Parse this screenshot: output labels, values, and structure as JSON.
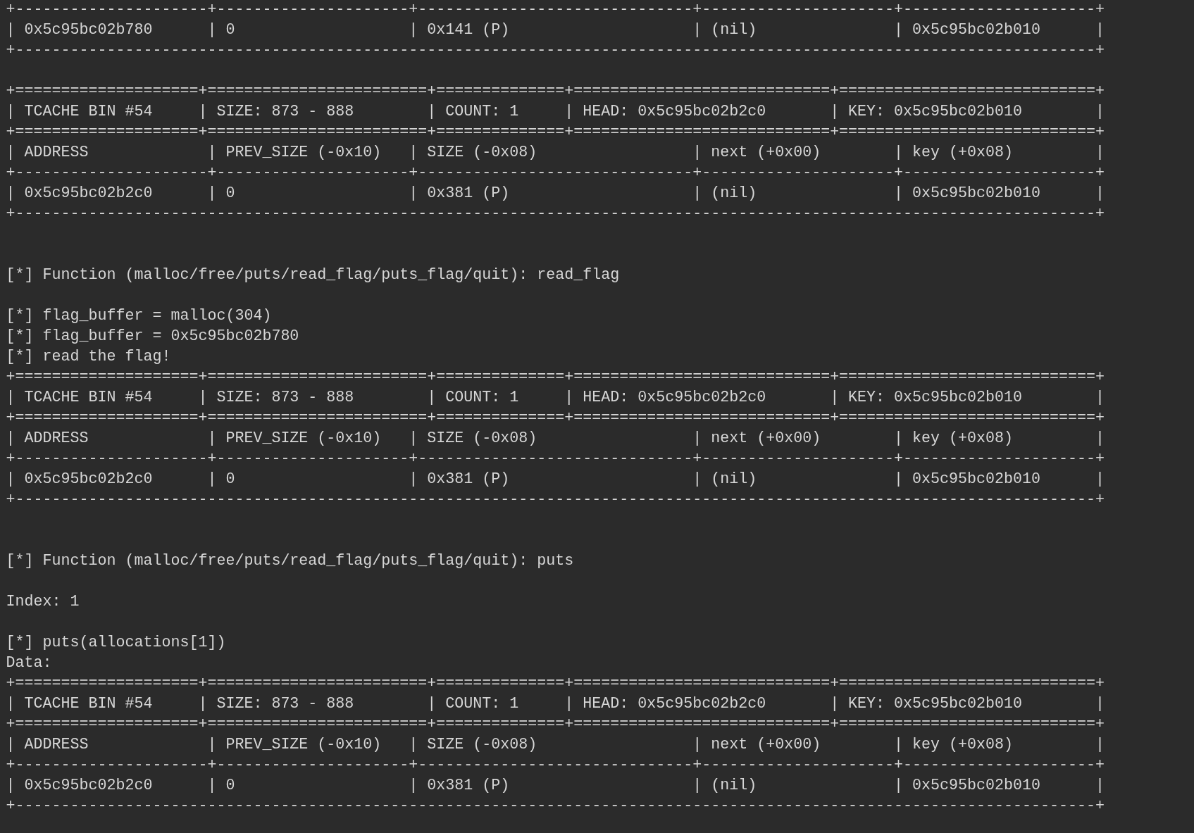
{
  "terminal": {
    "steps": [
      {
        "bins": [
          {
            "rules": [
              "+---------------------+---------------------+------------------------------+---------------------+---------------------+",
              "+----------------------------------------------------------------------------------------------------------------------+"
            ],
            "rows": [
              "| 0x5c95bc02b780      | 0                   | 0x141 (P)                    | (nil)               | 0x5c95bc02b010      |"
            ]
          },
          {
            "rules": [
              "+====================+========================+==============+============================+============================+",
              "+====================+========================+==============+============================+============================+",
              "+---------------------+---------------------+------------------------------+---------------------+---------------------+",
              "+----------------------------------------------------------------------------------------------------------------------+"
            ],
            "rows": [
              "| TCACHE BIN #54     | SIZE: 873 - 888        | COUNT: 1     | HEAD: 0x5c95bc02b2c0       | KEY: 0x5c95bc02b010        |",
              "| ADDRESS             | PREV_SIZE (-0x10)   | SIZE (-0x08)                 | next (+0x00)        | key (+0x08)         |",
              "| 0x5c95bc02b2c0      | 0                   | 0x381 (P)                    | (nil)               | 0x5c95bc02b010      |"
            ]
          }
        ]
      },
      {
        "prompt": "[*] Function (malloc/free/puts/read_flag/puts_flag/quit): read_flag",
        "output": [
          "[*] flag_buffer = malloc(304)",
          "[*] flag_buffer = 0x5c95bc02b780",
          "[*] read the flag!"
        ],
        "bins": [
          {
            "rules": [
              "+====================+========================+==============+============================+============================+",
              "+====================+========================+==============+============================+============================+",
              "+---------------------+---------------------+------------------------------+---------------------+---------------------+",
              "+----------------------------------------------------------------------------------------------------------------------+"
            ],
            "rows": [
              "| TCACHE BIN #54     | SIZE: 873 - 888        | COUNT: 1     | HEAD: 0x5c95bc02b2c0       | KEY: 0x5c95bc02b010        |",
              "| ADDRESS             | PREV_SIZE (-0x10)   | SIZE (-0x08)                 | next (+0x00)        | key (+0x08)         |",
              "| 0x5c95bc02b2c0      | 0                   | 0x381 (P)                    | (nil)               | 0x5c95bc02b010      |"
            ]
          }
        ]
      },
      {
        "prompt": "[*] Function (malloc/free/puts/read_flag/puts_flag/quit): puts",
        "index_prompt": "Index: 1",
        "output": [
          "[*] puts(allocations[1])",
          "Data:"
        ],
        "bins": [
          {
            "rules": [
              "+====================+========================+==============+============================+============================+",
              "+====================+========================+==============+============================+============================+",
              "+---------------------+---------------------+------------------------------+---------------------+---------------------+",
              "+----------------------------------------------------------------------------------------------------------------------+"
            ],
            "rows": [
              "| TCACHE BIN #54     | SIZE: 873 - 888        | COUNT: 1     | HEAD: 0x5c95bc02b2c0       | KEY: 0x5c95bc02b010        |",
              "| ADDRESS             | PREV_SIZE (-0x10)   | SIZE (-0x08)                 | next (+0x00)        | key (+0x08)         |",
              "| 0x5c95bc02b2c0      | 0                   | 0x381 (P)                    | (nil)               | 0x5c95bc02b010      |"
            ]
          }
        ]
      }
    ]
  }
}
